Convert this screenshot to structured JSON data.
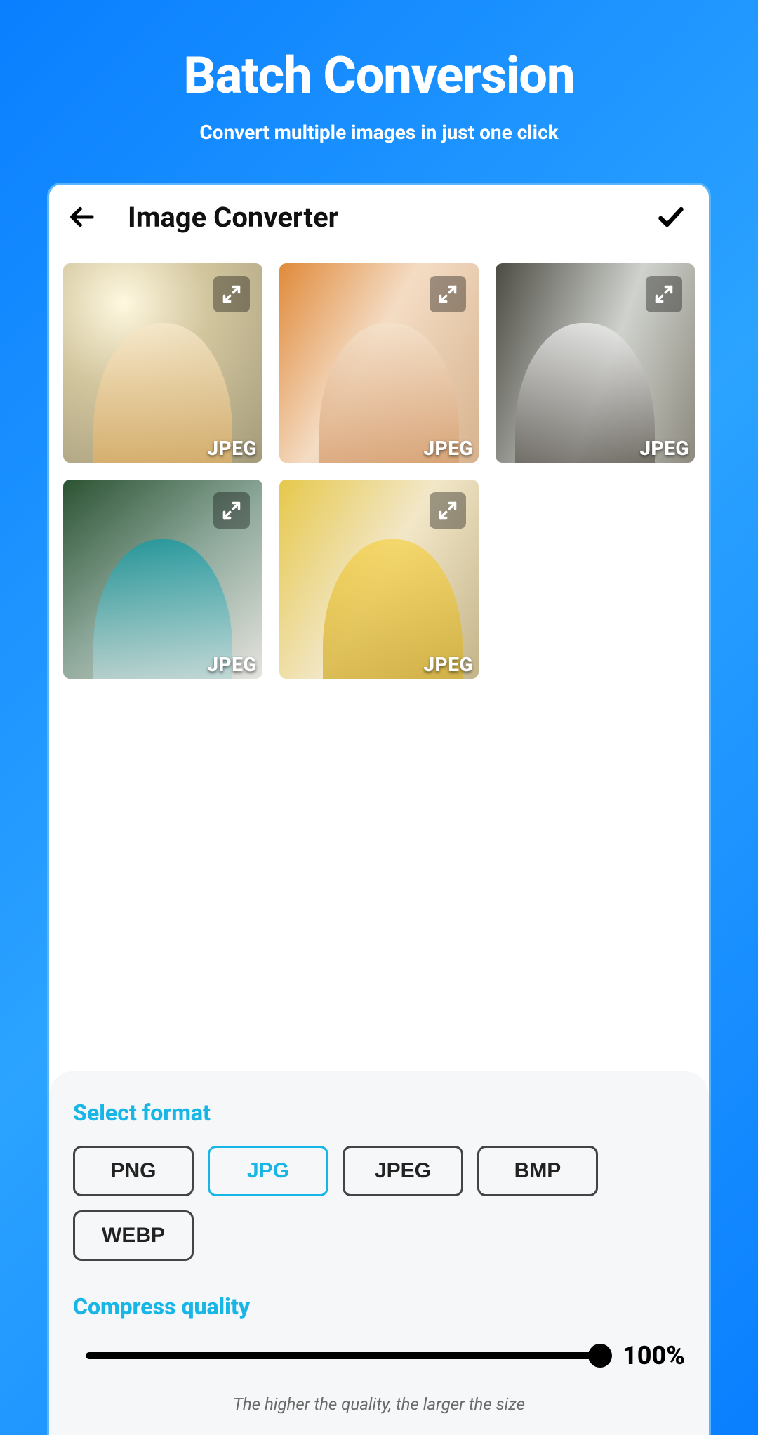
{
  "hero": {
    "title": "Batch Conversion",
    "subtitle": "Convert multiple images in just one click"
  },
  "app": {
    "title": "Image Converter"
  },
  "thumbs": [
    {
      "format": "JPEG"
    },
    {
      "format": "JPEG"
    },
    {
      "format": "JPEG"
    },
    {
      "format": "JPEG"
    },
    {
      "format": "JPEG"
    }
  ],
  "panel": {
    "format_label": "Select format",
    "formats": [
      {
        "label": "PNG",
        "selected": false
      },
      {
        "label": "JPG",
        "selected": true
      },
      {
        "label": "JPEG",
        "selected": false
      },
      {
        "label": "BMP",
        "selected": false
      },
      {
        "label": "WEBP",
        "selected": false
      }
    ],
    "quality_label": "Compress quality",
    "quality_value": "100%",
    "quality_percent": 100,
    "hint": "The higher the quality, the larger the size"
  }
}
